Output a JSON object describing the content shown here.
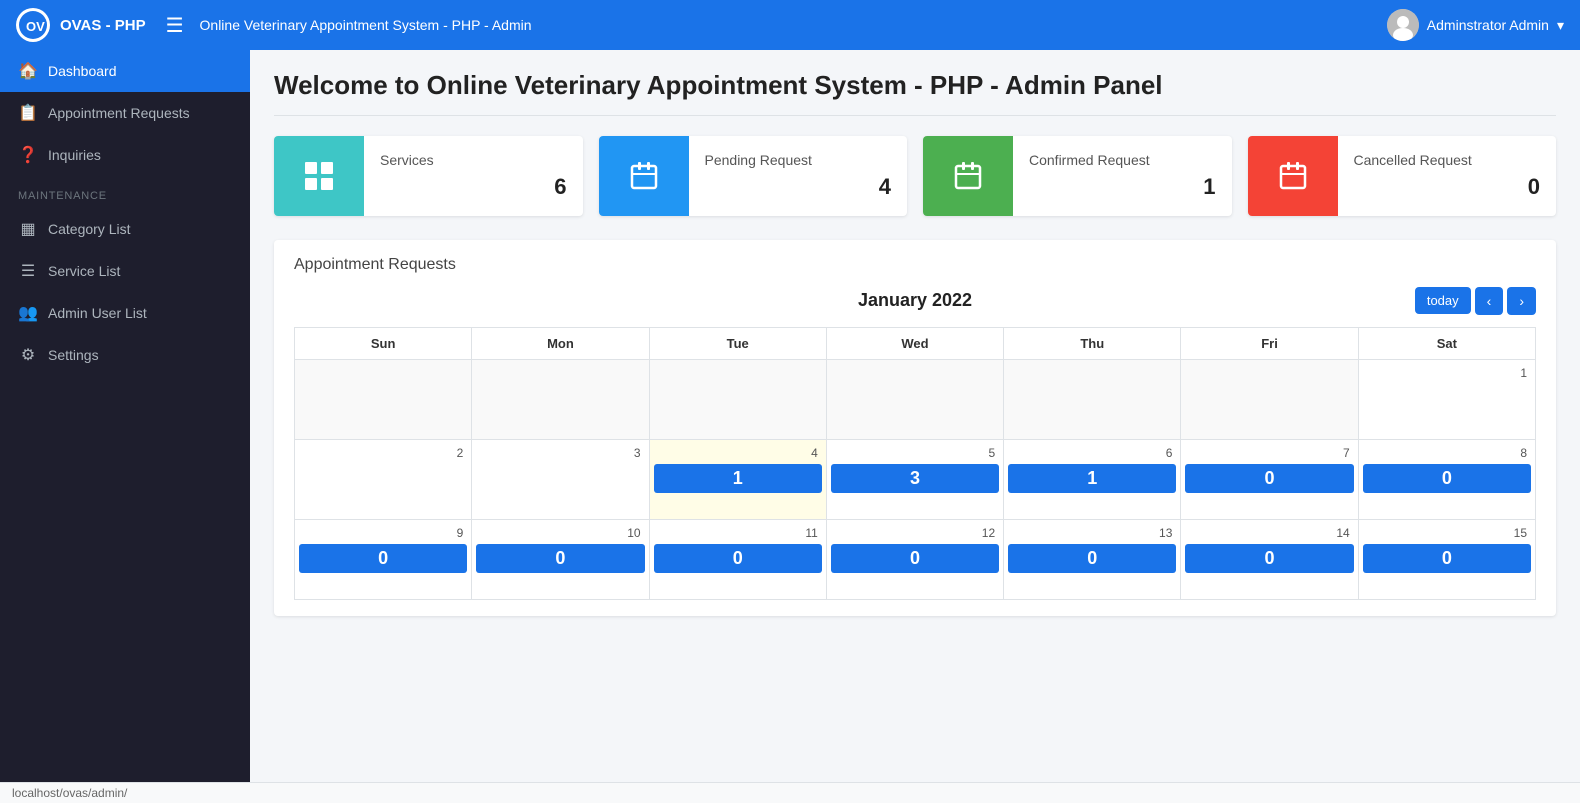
{
  "app": {
    "brand": "OVAS - PHP",
    "nav_title": "Online Veterinary Appointment System - PHP - Admin",
    "user_label": "Adminstrator Admin",
    "status_bar": "localhost/ovas/admin/"
  },
  "sidebar": {
    "active_item": "Dashboard",
    "items": [
      {
        "id": "dashboard",
        "label": "Dashboard",
        "icon": "🏠",
        "active": true
      },
      {
        "id": "appointment-requests",
        "label": "Appointment Requests",
        "icon": "📋",
        "active": false
      },
      {
        "id": "inquiries",
        "label": "Inquiries",
        "icon": "❓",
        "active": false
      }
    ],
    "maintenance_label": "Maintenance",
    "maintenance_items": [
      {
        "id": "category-list",
        "label": "Category List",
        "icon": "▦",
        "active": false
      },
      {
        "id": "service-list",
        "label": "Service List",
        "icon": "☰",
        "active": false
      },
      {
        "id": "admin-user-list",
        "label": "Admin User List",
        "icon": "👥",
        "active": false
      },
      {
        "id": "settings",
        "label": "Settings",
        "icon": "⚙",
        "active": false
      }
    ]
  },
  "page": {
    "heading": "Welcome to Online Veterinary Appointment System - PHP - Admin Panel"
  },
  "stats": [
    {
      "id": "services",
      "label": "Services",
      "value": "6",
      "color": "teal",
      "icon": "▦"
    },
    {
      "id": "pending-request",
      "label": "Pending Request",
      "value": "4",
      "color": "blue",
      "icon": "📅"
    },
    {
      "id": "confirmed-request",
      "label": "Confirmed Request",
      "value": "1",
      "color": "green",
      "icon": "📅"
    },
    {
      "id": "cancelled-request",
      "label": "Cancelled Request",
      "value": "0",
      "color": "red",
      "icon": "📅"
    }
  ],
  "calendar": {
    "section_title": "Appointment Requests",
    "month_title": "January 2022",
    "today_label": "today",
    "prev_label": "‹",
    "next_label": "›",
    "days": [
      "Sun",
      "Mon",
      "Tue",
      "Wed",
      "Thu",
      "Fri",
      "Sat"
    ],
    "weeks": [
      [
        {
          "date": "",
          "count": null,
          "highlight": false,
          "empty": true
        },
        {
          "date": "",
          "count": null,
          "highlight": false,
          "empty": true
        },
        {
          "date": "",
          "count": null,
          "highlight": false,
          "empty": true
        },
        {
          "date": "",
          "count": null,
          "highlight": false,
          "empty": true
        },
        {
          "date": "",
          "count": null,
          "highlight": false,
          "empty": true
        },
        {
          "date": "",
          "count": null,
          "highlight": false,
          "empty": true
        },
        {
          "date": "1",
          "count": null,
          "highlight": false,
          "empty": true
        }
      ],
      [
        {
          "date": "2",
          "count": null,
          "highlight": false,
          "empty": true
        },
        {
          "date": "3",
          "count": null,
          "highlight": false,
          "empty": true
        },
        {
          "date": "4",
          "count": 1,
          "highlight": true,
          "empty": false
        },
        {
          "date": "5",
          "count": 3,
          "highlight": false,
          "empty": false
        },
        {
          "date": "6",
          "count": 1,
          "highlight": false,
          "empty": false
        },
        {
          "date": "7",
          "count": 0,
          "highlight": false,
          "empty": false
        },
        {
          "date": "8",
          "count": 0,
          "highlight": false,
          "empty": false
        }
      ],
      [
        {
          "date": "9",
          "count": 0,
          "highlight": false,
          "empty": false
        },
        {
          "date": "10",
          "count": 0,
          "highlight": false,
          "empty": false
        },
        {
          "date": "11",
          "count": 0,
          "highlight": false,
          "empty": false
        },
        {
          "date": "12",
          "count": 0,
          "highlight": false,
          "empty": false
        },
        {
          "date": "13",
          "count": 0,
          "highlight": false,
          "empty": false
        },
        {
          "date": "14",
          "count": 0,
          "highlight": false,
          "empty": false
        },
        {
          "date": "15",
          "count": 0,
          "highlight": false,
          "empty": false
        }
      ]
    ]
  }
}
